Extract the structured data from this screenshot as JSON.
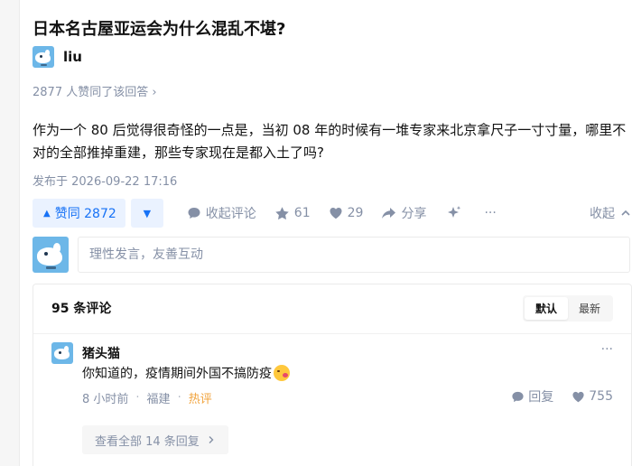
{
  "question": {
    "title": "日本名古屋亚运会为什么混乱不堪?"
  },
  "answer": {
    "author": "liu",
    "likes_summary": "2877 人赞同了该回答 ›",
    "content": "作为一个 80 后觉得很奇怪的一点是，当初 08 年的时候有一堆专家来北京拿尺子一寸寸量，哪里不对的全部推掉重建，那些专家现在是都入土了吗?",
    "published": "发布于 2026-09-22 17:16"
  },
  "actions": {
    "vote_label": "赞同 2872",
    "comment_label": "收起评论",
    "star_count": "61",
    "heart_count": "29",
    "share_label": "分享",
    "more_label": "···",
    "collapse_label": "收起"
  },
  "reply": {
    "placeholder": "理性发言，友善互动"
  },
  "comments": {
    "count_label": "95 条评论",
    "sort_default": "默认",
    "sort_latest": "最新",
    "items": [
      {
        "name": "猪头猫",
        "text": "你知道的，疫情期间外国不搞防疫",
        "time": "8 小时前",
        "location": "福建",
        "tag": "热评",
        "reply_label": "回复",
        "likes": "755",
        "view_all": "查看全部 14 条回复"
      }
    ]
  },
  "colors": {
    "accent": "#1772f6",
    "accent_bg": "#eaf2ff",
    "muted": "#8590a6",
    "hot": "#f1a33c",
    "avatar": "#6db7e8"
  },
  "icons": [
    "comment-icon",
    "star-icon",
    "heart-icon",
    "share-icon",
    "sparkle-icon",
    "more-icon",
    "chevron-up-icon",
    "chevron-right-icon"
  ]
}
